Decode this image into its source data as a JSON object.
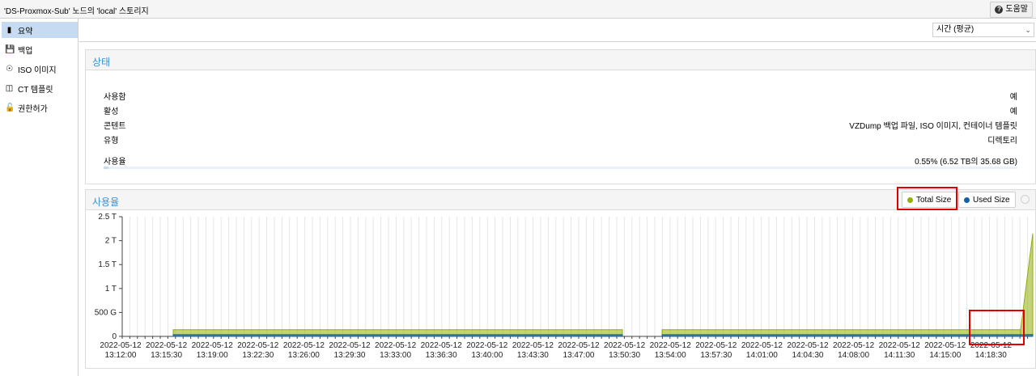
{
  "header": {
    "title": "'DS-Proxmox-Sub' 노드의 'local' 스토리지",
    "help_label": "도움말"
  },
  "sidebar": {
    "items": [
      {
        "label": "요약",
        "icon": "book-icon",
        "selected": true
      },
      {
        "label": "백업",
        "icon": "floppy-icon",
        "selected": false
      },
      {
        "label": "ISO 이미지",
        "icon": "disc-icon",
        "selected": false
      },
      {
        "label": "CT 템플릿",
        "icon": "template-icon",
        "selected": false
      },
      {
        "label": "권한허가",
        "icon": "unlock-icon",
        "selected": false
      }
    ]
  },
  "toolbar": {
    "timeframe": "시간 (평균)"
  },
  "status": {
    "title": "상태",
    "rows": [
      {
        "label": "사용함",
        "value": "예"
      },
      {
        "label": "활성",
        "value": "예"
      },
      {
        "label": "콘텐트",
        "value": "VZDump 백업 파일, ISO 이미지, 컨테이너 템플릿"
      },
      {
        "label": "유형",
        "value": "디렉토리"
      }
    ],
    "usage": {
      "label": "사용율",
      "value": "0.55% (6.52 TB의 35.68 GB)",
      "fraction": 0.0055
    }
  },
  "usage_chart": {
    "title": "사용율"
  },
  "chart_data": {
    "type": "area",
    "series": [
      {
        "name": "Total Size",
        "color": "#94ae0a",
        "values_tb": [
          0.14,
          0.14,
          2.15
        ]
      },
      {
        "name": "Used Size",
        "color": "#115fa6",
        "values_tb": [
          0.035,
          0.035,
          0.04
        ]
      }
    ],
    "y_ticks": [
      "2.5 T",
      "2 T",
      "1.5 T",
      "1 T",
      "500 G",
      "0"
    ],
    "ylim_tb": [
      0,
      2.5
    ],
    "x_ticks": [
      [
        "2022-05-12",
        "13:12:00"
      ],
      [
        "2022-05-12",
        "13:15:30"
      ],
      [
        "2022-05-12",
        "13:19:00"
      ],
      [
        "2022-05-12",
        "13:22:30"
      ],
      [
        "2022-05-12",
        "13:26:00"
      ],
      [
        "2022-05-12",
        "13:29:30"
      ],
      [
        "2022-05-12",
        "13:33:00"
      ],
      [
        "2022-05-12",
        "13:36:30"
      ],
      [
        "2022-05-12",
        "13:40:00"
      ],
      [
        "2022-05-12",
        "13:43:30"
      ],
      [
        "2022-05-12",
        "13:47:00"
      ],
      [
        "2022-05-12",
        "13:50:30"
      ],
      [
        "2022-05-12",
        "13:54:00"
      ],
      [
        "2022-05-12",
        "13:57:30"
      ],
      [
        "2022-05-12",
        "14:01:00"
      ],
      [
        "2022-05-12",
        "14:04:30"
      ],
      [
        "2022-05-12",
        "14:08:00"
      ],
      [
        "2022-05-12",
        "14:11:30"
      ],
      [
        "2022-05-12",
        "14:15:00"
      ],
      [
        "2022-05-12",
        "14:18:30"
      ]
    ],
    "grid": true
  }
}
